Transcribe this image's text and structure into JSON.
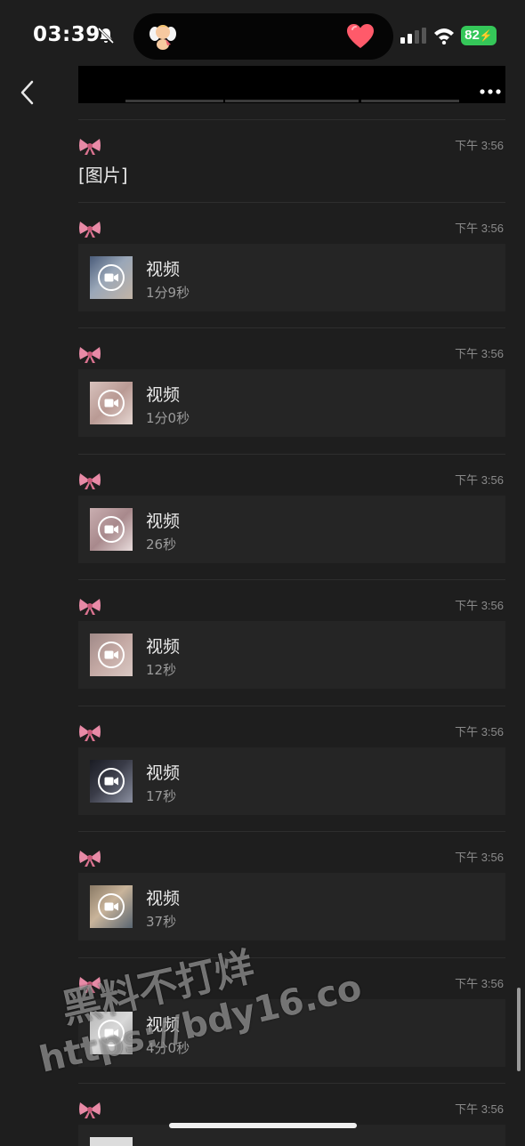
{
  "status_bar": {
    "time": "03:39",
    "battery": "82",
    "icons": [
      "bell-muted-icon",
      "cherub-icon",
      "heart-icon",
      "signal-icon",
      "wifi-icon",
      "battery-icon"
    ]
  },
  "colors": {
    "background": "#1e1e1e",
    "card": "#252525",
    "battery": "#35c759",
    "heart": "#ff5a6a",
    "bow": "#e88aa6"
  },
  "messages": [
    {
      "type": "text",
      "time": "下午 3:56",
      "text": "[图片]"
    },
    {
      "type": "video",
      "time": "下午 3:56",
      "title": "视频",
      "duration": "1分9秒"
    },
    {
      "type": "video",
      "time": "下午 3:56",
      "title": "视频",
      "duration": "1分0秒"
    },
    {
      "type": "video",
      "time": "下午 3:56",
      "title": "视频",
      "duration": "26秒"
    },
    {
      "type": "video",
      "time": "下午 3:56",
      "title": "视频",
      "duration": "12秒"
    },
    {
      "type": "video",
      "time": "下午 3:56",
      "title": "视频",
      "duration": "17秒"
    },
    {
      "type": "video",
      "time": "下午 3:56",
      "title": "视频",
      "duration": "37秒"
    },
    {
      "type": "video",
      "time": "下午 3:56",
      "title": "视频",
      "duration": "4分0秒"
    },
    {
      "type": "video",
      "time": "下午 3:56",
      "title": "",
      "duration": ""
    }
  ],
  "watermark": {
    "line1": "黑料不打烊",
    "line2": "https://bdy16.co"
  }
}
